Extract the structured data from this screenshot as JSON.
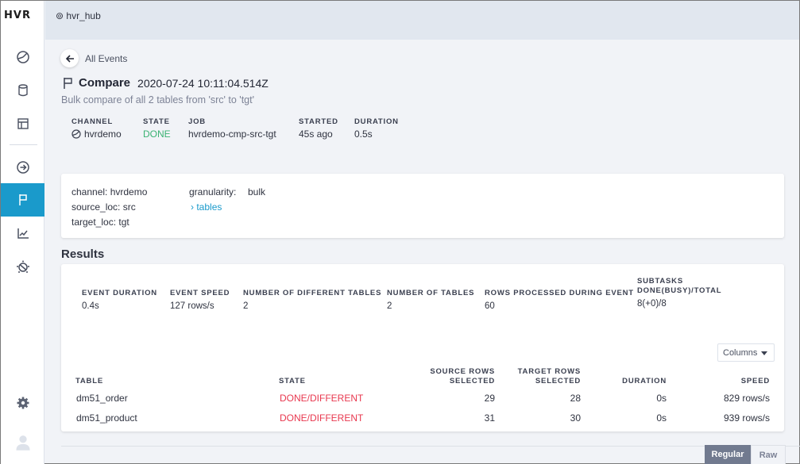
{
  "app": {
    "logo": "HVR",
    "hub": "hvr_hub"
  },
  "sidebar": {
    "items": [
      {
        "name": "dashboard",
        "icon": "pie-chart-icon",
        "active": false
      },
      {
        "name": "locations",
        "icon": "database-icon",
        "active": false
      },
      {
        "name": "tables",
        "icon": "table-icon",
        "active": false
      },
      {
        "name": "jobs",
        "icon": "arrow-circle-right-icon",
        "active": false
      },
      {
        "name": "events",
        "icon": "flag-icon",
        "active": true
      },
      {
        "name": "statistics",
        "icon": "line-chart-icon",
        "active": false
      },
      {
        "name": "topology",
        "icon": "topology-icon",
        "active": false
      }
    ],
    "bottom": [
      {
        "name": "settings",
        "icon": "gear-icon"
      },
      {
        "name": "user",
        "icon": "user-icon"
      }
    ],
    "active_color": "#1a9acb"
  },
  "header": {
    "back_label": "All Events",
    "title": "Compare",
    "timestamp": "2020-07-24  10:11:04.514Z",
    "subtitle": "Bulk compare of all 2 tables from 'src' to 'tgt'"
  },
  "meta": {
    "channel": {
      "label": "CHANNEL",
      "value": "hvrdemo"
    },
    "state": {
      "label": "STATE",
      "value": "DONE",
      "color": "#3bb273"
    },
    "job": {
      "label": "JOB",
      "value": "hvrdemo-cmp-src-tgt"
    },
    "started": {
      "label": "STARTED",
      "value": "45s ago"
    },
    "duration": {
      "label": "DURATION",
      "value": "0.5s"
    }
  },
  "params": {
    "channel": "channel: hvrdemo",
    "source_loc": "source_loc: src",
    "target_loc": "target_loc: tgt",
    "granularity_label": "granularity:",
    "granularity_value": "bulk",
    "tables_link": "tables"
  },
  "results": {
    "title": "Results",
    "stats": [
      {
        "label": "EVENT DURATION",
        "value": "0.4s"
      },
      {
        "label": "EVENT SPEED",
        "value": "127 rows/s"
      },
      {
        "label": "NUMBER OF DIFFERENT TABLES",
        "value": "2"
      },
      {
        "label": "NUMBER OF TABLES",
        "value": "2"
      },
      {
        "label": "ROWS PROCESSED DURING EVENT",
        "value": "60"
      },
      {
        "label_line1": "SUBTASKS",
        "label_line2": "DONE(BUSY)/TOTAL",
        "value": "8(+0)/8"
      }
    ],
    "columns_button": "Columns",
    "table": {
      "headers": {
        "table": "TABLE",
        "state": "STATE",
        "source_1": "SOURCE ROWS",
        "source_2": "SELECTED",
        "target_1": "TARGET ROWS",
        "target_2": "SELECTED",
        "duration": "DURATION",
        "speed": "SPEED"
      },
      "rows": [
        {
          "table": "dm51_order",
          "state": "DONE/DIFFERENT",
          "source": "29",
          "target": "28",
          "duration": "0s",
          "speed": "829 rows/s"
        },
        {
          "table": "dm51_product",
          "state": "DONE/DIFFERENT",
          "source": "31",
          "target": "30",
          "duration": "0s",
          "speed": "939 rows/s"
        }
      ],
      "state_color": "#e8384f"
    }
  },
  "view_toggle": {
    "regular": "Regular",
    "raw": "Raw",
    "selected": "Regular"
  }
}
